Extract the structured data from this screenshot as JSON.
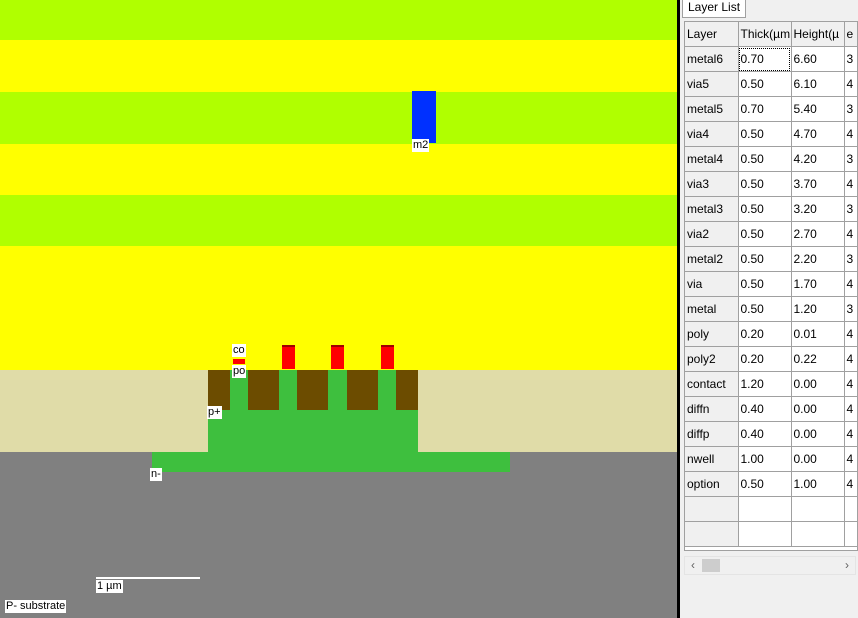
{
  "colors": {
    "yellow": "#ffff00",
    "green_band": "#b0ff00",
    "oxide": "#e0dca8",
    "substrate": "#808080",
    "diffusion": "#3ebf3e",
    "poly": "#6c4c00",
    "contact": "#ff0000",
    "metal2": "#0030ff"
  },
  "view": {
    "label_m2": "m2",
    "label_co": "co",
    "label_po": "po",
    "label_p_plus": "p+",
    "label_n_minus": "n-",
    "scale_label": "1 µm",
    "substrate_label": "P- substrate"
  },
  "panel": {
    "tab_label": "Layer List",
    "headers": [
      "Layer",
      "Thick(µm",
      "Height(µ",
      "e"
    ],
    "rows": [
      [
        "metal6",
        "0.70",
        "6.60",
        "3"
      ],
      [
        "via5",
        "0.50",
        "6.10",
        "4"
      ],
      [
        "metal5",
        "0.70",
        "5.40",
        "3"
      ],
      [
        "via4",
        "0.50",
        "4.70",
        "4"
      ],
      [
        "metal4",
        "0.50",
        "4.20",
        "3"
      ],
      [
        "via3",
        "0.50",
        "3.70",
        "4"
      ],
      [
        "metal3",
        "0.50",
        "3.20",
        "3"
      ],
      [
        "via2",
        "0.50",
        "2.70",
        "4"
      ],
      [
        "metal2",
        "0.50",
        "2.20",
        "3"
      ],
      [
        "via",
        "0.50",
        "1.70",
        "4"
      ],
      [
        "metal",
        "0.50",
        "1.20",
        "3"
      ],
      [
        "poly",
        "0.20",
        "0.01",
        "4"
      ],
      [
        "poly2",
        "0.20",
        "0.22",
        "4"
      ],
      [
        "contact",
        "1.20",
        "0.00",
        "4"
      ],
      [
        "diffn",
        "0.40",
        "0.00",
        "4"
      ],
      [
        "diffp",
        "0.40",
        "0.00",
        "4"
      ],
      [
        "nwell",
        "1.00",
        "0.00",
        "4"
      ],
      [
        "option",
        "0.50",
        "1.00",
        "4"
      ],
      [
        "",
        "",
        "",
        ""
      ],
      [
        "",
        "",
        "",
        ""
      ]
    ],
    "scroll_left": "‹",
    "scroll_right": "›"
  }
}
